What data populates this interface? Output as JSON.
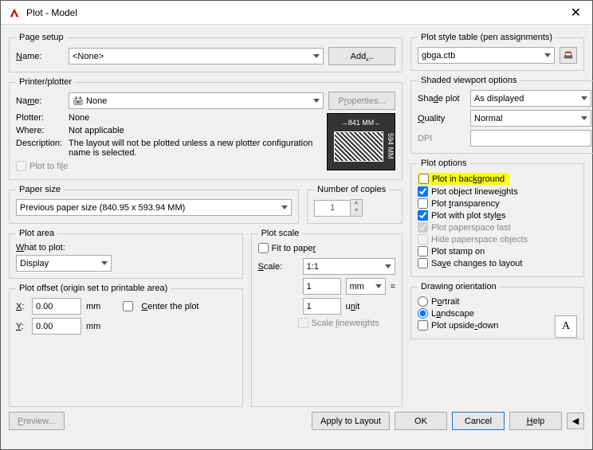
{
  "title": "Plot - Model",
  "pageSetup": {
    "legend": "Page setup",
    "nameLabel": "Name:",
    "nameValue": "<None>",
    "addBtn": "Add..."
  },
  "printer": {
    "legend": "Printer/plotter",
    "nameLabel": "Name:",
    "nameValue": "None",
    "propsBtn": "Properties...",
    "plotterLabel": "Plotter:",
    "plotterValue": "None",
    "whereLabel": "Where:",
    "whereValue": "Not applicable",
    "descLabel": "Description:",
    "descValue": "The layout will not be plotted unless a new plotter configuration name is selected.",
    "plotToFile": "Plot to file",
    "dimW": "841 MM",
    "dimH": "594 MM"
  },
  "paper": {
    "legend": "Paper size",
    "value": "Previous paper size (840.95 x 593.94 MM)"
  },
  "copies": {
    "legend": "Number of copies",
    "value": "1"
  },
  "plotArea": {
    "legend": "Plot area",
    "whatLabel": "What to plot:",
    "value": "Display"
  },
  "plotScale": {
    "legend": "Plot scale",
    "fit": "Fit to paper",
    "scaleLabel": "Scale:",
    "scaleValue": "1:1",
    "numA": "1",
    "unitA": "mm",
    "numB": "1",
    "unitBLabel": "unit",
    "lineweights": "Scale lineweights"
  },
  "plotOffset": {
    "legend": "Plot offset (origin set to printable area)",
    "xLabel": "X:",
    "xValue": "0.00",
    "yLabel": "Y:",
    "yValue": "0.00",
    "mm": "mm",
    "center": "Center the plot"
  },
  "styleTable": {
    "legend": "Plot style table (pen assignments)",
    "value": "gbga.ctb"
  },
  "shaded": {
    "legend": "Shaded viewport options",
    "shadeLabel": "Shade plot",
    "shadeValue": "As displayed",
    "qualityLabel": "Quality",
    "qualityValue": "Normal",
    "dpiLabel": "DPI",
    "dpiValue": ""
  },
  "plotOptions": {
    "legend": "Plot options",
    "background": "Plot in background",
    "objLine": "Plot object lineweights",
    "transparency": "Plot transparency",
    "withStyles": "Plot with plot styles",
    "paperspace": "Plot paperspace last",
    "hidePaperspace": "Hide paperspace objects",
    "stamp": "Plot stamp on",
    "saveChanges": "Save changes to layout"
  },
  "orientation": {
    "legend": "Drawing orientation",
    "portrait": "Portrait",
    "landscape": "Landscape",
    "upside": "Plot upside-down",
    "letter": "A"
  },
  "footer": {
    "preview": "Preview...",
    "apply": "Apply to Layout",
    "ok": "OK",
    "cancel": "Cancel",
    "help": "Help"
  }
}
